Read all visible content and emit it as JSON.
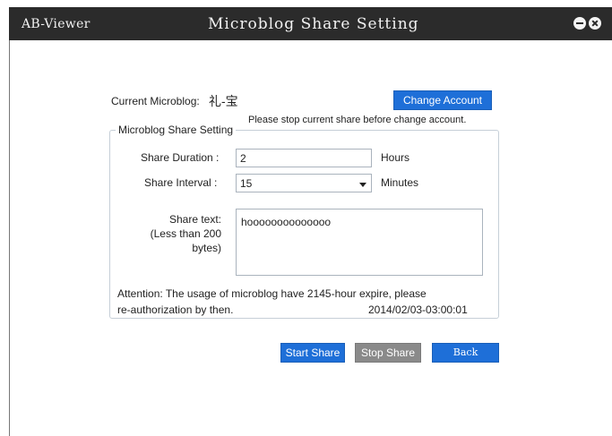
{
  "window": {
    "app_title": "AB-Viewer",
    "title": "Microblog Share Setting"
  },
  "account": {
    "label": "Current Microblog:",
    "value": "礼-宝",
    "change_button": "Change Account",
    "notice": "Please stop current share before change account."
  },
  "settings": {
    "group_title": "Microblog Share Setting",
    "duration_label": "Share Duration :",
    "duration_value": "2",
    "duration_unit": "Hours",
    "interval_label": "Share Interval :",
    "interval_value": "15",
    "interval_unit": "Minutes",
    "text_label_line1": "Share text:",
    "text_label_line2": "(Less than 200",
    "text_label_line3": "bytes)",
    "text_value": "hoooooooooooooo",
    "attention_line1": "Attention: The usage of microblog have 2145-hour expire, please",
    "attention_line2": "re-authorization by then.",
    "expire_time": "2014/02/03-03:00:01"
  },
  "actions": {
    "start": "Start Share",
    "stop": "Stop Share",
    "back": "Back"
  }
}
